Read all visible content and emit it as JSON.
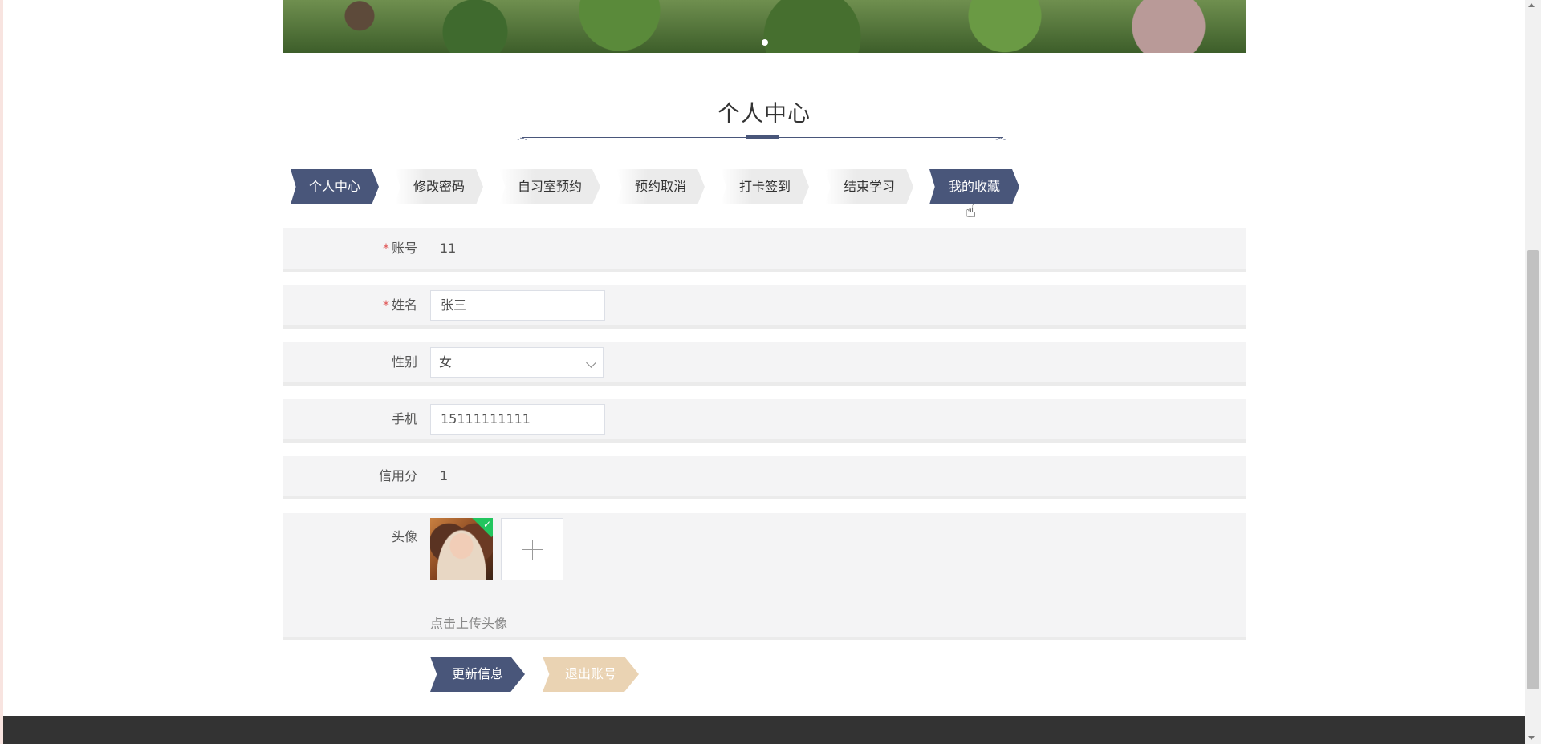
{
  "section": {
    "title": "个人中心"
  },
  "tabs": [
    {
      "label": "个人中心",
      "active": true
    },
    {
      "label": "修改密码",
      "active": false
    },
    {
      "label": "自习室预约",
      "active": false
    },
    {
      "label": "预约取消",
      "active": false
    },
    {
      "label": "打卡签到",
      "active": false
    },
    {
      "label": "结束学习",
      "active": false
    },
    {
      "label": "我的收藏",
      "active": true
    }
  ],
  "form": {
    "account": {
      "label": "账号",
      "required_mark": "*",
      "value": "11"
    },
    "name": {
      "label": "姓名",
      "required_mark": "*",
      "value": "张三"
    },
    "gender": {
      "label": "性别",
      "value": "女"
    },
    "phone": {
      "label": "手机",
      "value": "15111111111"
    },
    "credit": {
      "label": "信用分",
      "value": "1"
    },
    "avatar": {
      "label": "头像",
      "hint": "点击上传头像",
      "check_glyph": "✓"
    }
  },
  "buttons": {
    "update": "更新信息",
    "logout": "退出账号"
  },
  "colors": {
    "primary": "#49567a",
    "secondary": "#ead3b3",
    "required": "#e05656",
    "footer": "#333333"
  }
}
